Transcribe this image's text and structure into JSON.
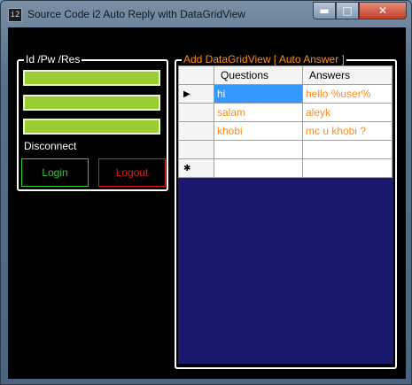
{
  "window": {
    "title": "Source Code i2 Auto Reply with DataGridView",
    "icon": "app-icon",
    "minimize_glyph": "▬",
    "maximize_glyph": "□",
    "close_glyph": "✕"
  },
  "login_group": {
    "caption": "Id /Pw /Res",
    "fields": [
      {
        "name": "id-field",
        "value": ""
      },
      {
        "name": "password-field",
        "value": ""
      },
      {
        "name": "res-field",
        "value": ""
      }
    ],
    "status": "Disconnect",
    "login_label": "Login",
    "logout_label": "Logout"
  },
  "grid_group": {
    "caption": "Add DataGridView [ Auto Answer ]",
    "columns": [
      "Questions",
      "Answers"
    ],
    "current_row_glyph": "▶",
    "new_row_glyph": "✱",
    "rows": [
      {
        "question": "hi",
        "answer": "hello %user%"
      },
      {
        "question": "salam",
        "answer": "aleyk"
      },
      {
        "question": "khobi",
        "answer": "mc u khobi ?"
      },
      {
        "question": "",
        "answer": ""
      }
    ]
  },
  "colors": {
    "client_background": "#000000",
    "textbox_fill": "#9acd32",
    "login_accent": "#2ecc2e",
    "logout_accent": "#e31b1b",
    "grid_caption": "#ff8c1a",
    "grid_background": "#191970",
    "selection": "#3399ff"
  }
}
